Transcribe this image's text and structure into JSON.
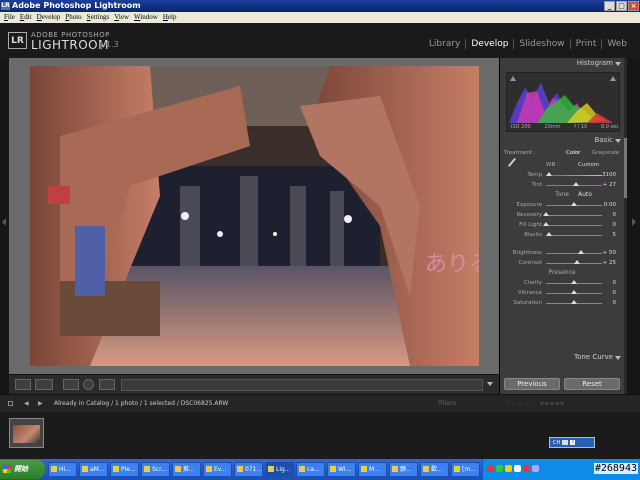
{
  "window": {
    "title": "Adobe Photoshop Lightroom"
  },
  "menu": [
    "File",
    "Edit",
    "Develop",
    "Photo",
    "Settings",
    "View",
    "Window",
    "Help"
  ],
  "identity": {
    "badge": "LR",
    "small": "ADOBE PHOTOSHOP",
    "big": "LIGHTROOM",
    "version": "1.3"
  },
  "modules": [
    {
      "label": "Library",
      "active": false
    },
    {
      "label": "Develop",
      "active": true
    },
    {
      "label": "Slideshow",
      "active": false
    },
    {
      "label": "Print",
      "active": false
    },
    {
      "label": "Web",
      "active": false
    }
  ],
  "histogram": {
    "header": "Histogram",
    "meta": [
      "ISO 200",
      "20mm",
      "f / 10",
      "8.0 sec"
    ]
  },
  "basic": {
    "header": "Basic",
    "treatment_label": "Treatment :",
    "color_label": "Color",
    "grayscale_label": "Grayscale",
    "wb_label": "WB :",
    "wb_value": "Custom",
    "temp": {
      "label": "Temp",
      "value": "3100",
      "level": 0.06
    },
    "tint": {
      "label": "Tint",
      "value": "+ 27",
      "level": 0.54
    },
    "tone_label": "Tone",
    "auto_label": "Auto",
    "tone": [
      {
        "label": "Exposure",
        "value": "0.00",
        "level": 0.5
      },
      {
        "label": "Recovery",
        "value": "0",
        "level": 0.0
      },
      {
        "label": "Fill Light",
        "value": "0",
        "level": 0.0
      },
      {
        "label": "Blacks",
        "value": "5",
        "level": 0.05
      },
      {
        "label": "Brightness",
        "value": "+ 50",
        "level": 0.62
      },
      {
        "label": "Contrast",
        "value": "+ 25",
        "level": 0.56
      }
    ],
    "presence_label": "Presence",
    "presence": [
      {
        "label": "Clarity",
        "value": "0",
        "level": 0.5
      },
      {
        "label": "Vibrance",
        "value": "0",
        "level": 0.5
      },
      {
        "label": "Saturation",
        "value": "0",
        "level": 0.5
      }
    ]
  },
  "tone_curve": {
    "header": "Tone Curve"
  },
  "buttons": {
    "previous": "Previous",
    "reset": "Reset"
  },
  "filmbar": {
    "text": "Already in Catalog / 1 photo / 1 selected / DSC06825.ARW",
    "filter_label": "Filters"
  },
  "ime": {
    "label": "CH"
  },
  "taskbar": {
    "start": "開始",
    "tasks": [
      "Hi...",
      "aM...",
      "Ple...",
      "Scr...",
      "推...",
      "Ev...",
      "071...",
      "Lig...",
      "ca...",
      "Wi...",
      "M...",
      "靜...",
      "歡...",
      "[m..."
    ]
  },
  "watermark": "#268943"
}
